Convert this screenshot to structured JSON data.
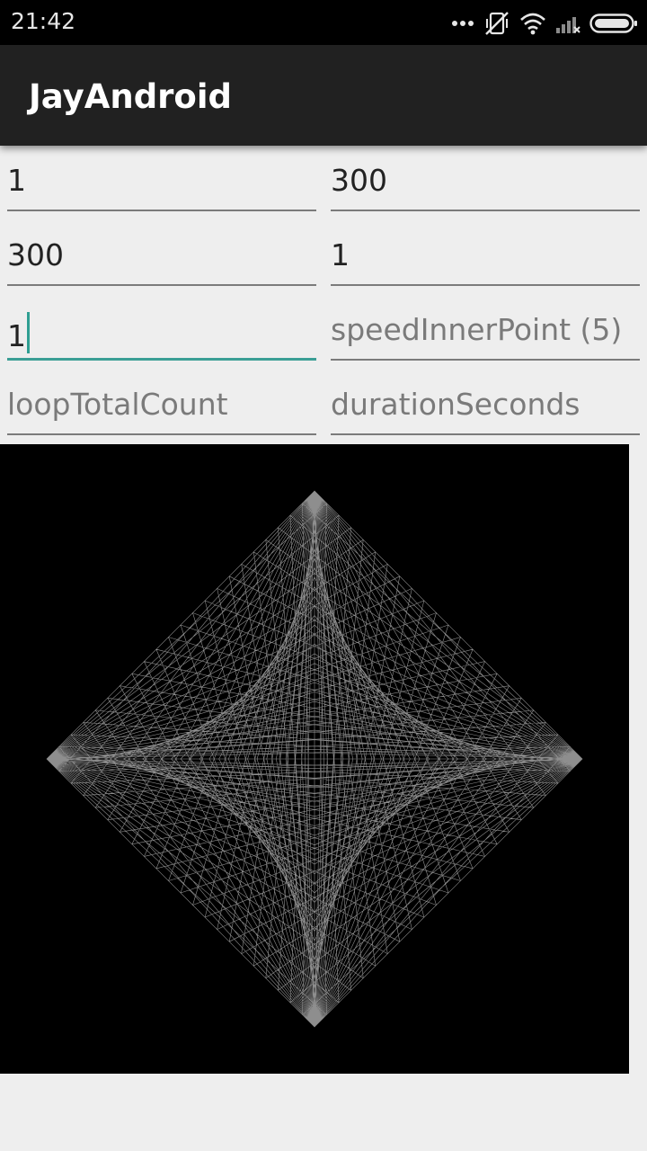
{
  "status_bar": {
    "time": "21:42",
    "icons": [
      "more-dots-icon",
      "vibrate-mute-icon",
      "wifi-icon",
      "signal-icon",
      "battery-icon"
    ]
  },
  "app_bar": {
    "title": "JayAndroid"
  },
  "fields": [
    {
      "value": "1",
      "placeholder": ""
    },
    {
      "value": "300",
      "placeholder": ""
    },
    {
      "value": "300",
      "placeholder": ""
    },
    {
      "value": "1",
      "placeholder": ""
    },
    {
      "value": "1",
      "placeholder": "",
      "focused": true
    },
    {
      "value": "",
      "placeholder": "speedInnerPoint (5)"
    },
    {
      "value": "",
      "placeholder": "loopTotalCount"
    },
    {
      "value": "",
      "placeholder": "durationSeconds"
    }
  ],
  "colors": {
    "accent": "#2e9e92",
    "canvas_background": "#000000",
    "line_color": "#bdbdbd"
  }
}
